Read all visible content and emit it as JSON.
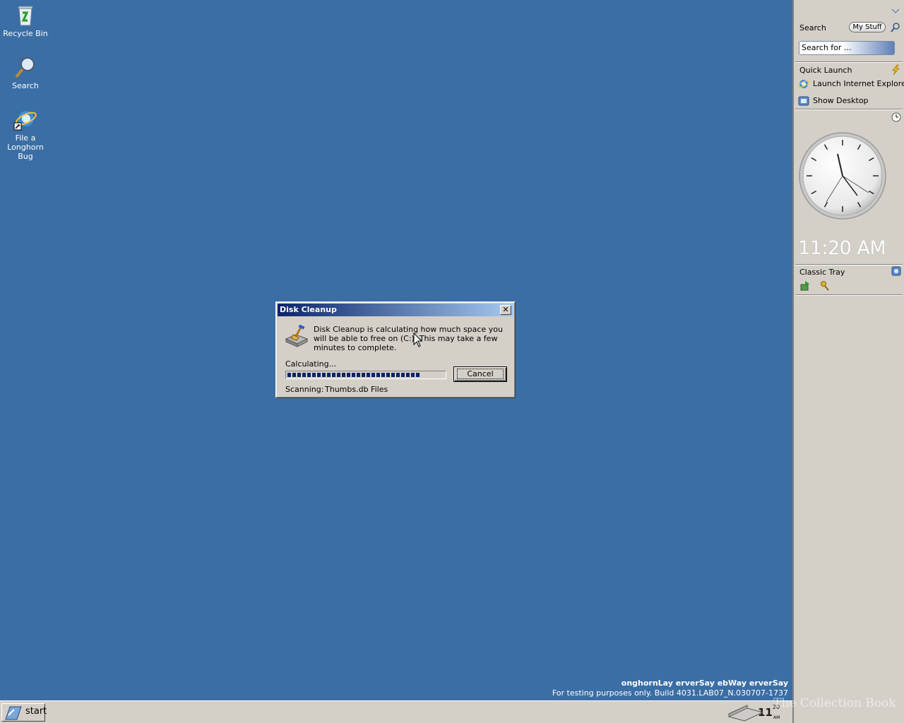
{
  "desktop": {
    "icons": [
      {
        "label": "Recycle Bin",
        "icon": "recycle-bin-icon"
      },
      {
        "label": "Search",
        "icon": "search-icon"
      },
      {
        "label": "File a\nLonghorn Bug",
        "icon": "internet-explorer-icon"
      }
    ],
    "watermark_line1": "onghornLay erverSay ebWay erverSay",
    "watermark_line2": "For testing purposes only. Build 4031.LAB07_N.030707-1737",
    "watermark_brand": "The Collection Book"
  },
  "dialog": {
    "title": "Disk Cleanup",
    "message": "Disk Cleanup is calculating how much space you will be able to free on  (C:). This may take a few minutes to complete.",
    "status_label": "Calculating...",
    "progress_fraction": 0.85,
    "cancel_label": "Cancel",
    "scanning_label": "Scanning:",
    "scanning_value": "Thumbs.db Files",
    "close_glyph": "✕"
  },
  "sidebar": {
    "search": {
      "title": "Search",
      "mystuff_label": "My Stuff",
      "placeholder": "Search for ..."
    },
    "quick_launch": {
      "title": "Quick Launch",
      "items": [
        {
          "label": "Launch Internet Explore",
          "icon": "internet-explorer-icon"
        },
        {
          "label": "Show Desktop",
          "icon": "show-desktop-icon"
        }
      ]
    },
    "clock": {
      "time": "11:20 AM"
    },
    "classic_tray": {
      "title": "Classic Tray"
    }
  },
  "taskbar": {
    "start_label": "start",
    "clock_hour": "11",
    "clock_minute": "20",
    "clock_ampm": "AM"
  },
  "colors": {
    "desktop": "#3a6ea5",
    "titlebar_start": "#0a246a",
    "titlebar_end": "#a6caf0",
    "chrome": "#d4d0c8"
  }
}
